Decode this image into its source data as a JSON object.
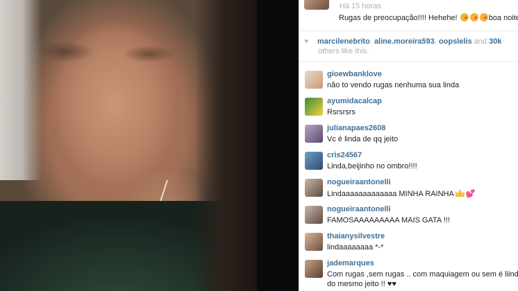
{
  "post": {
    "time": "Há 15 horas",
    "caption": "Rugas de preocupação!!!! Hehehe!",
    "caption_tail": "boa noite!"
  },
  "likes": {
    "users": [
      "marcilenebrito",
      "aline.moreira593",
      "oopslelis"
    ],
    "connector": "and",
    "count": "30k",
    "suffix": "others like this."
  },
  "comments": [
    {
      "username": "gioewbanklove",
      "text": "não to vendo rugas nenhuma sua linda",
      "avatar_colors": [
        "#e9d9c8",
        "#c89a7a"
      ]
    },
    {
      "username": "ayumidacalcap",
      "text": "Rsrsrsrs",
      "avatar_colors": [
        "#3a8a3c",
        "#f2d23a"
      ]
    },
    {
      "username": "julianapaes2608",
      "text": "Vc é linda de qq jeito",
      "avatar_colors": [
        "#b9a6c6",
        "#5c4a6a"
      ]
    },
    {
      "username": "cris24567",
      "text": "Linda,beijinho no ombro!!!!",
      "avatar_colors": [
        "#6fa0c8",
        "#2f4a6c"
      ]
    },
    {
      "username": "nogueiraantonelli",
      "text": "Lindaaaaaaaaaaaaa MINHA RAINHA",
      "avatar_colors": [
        "#c8b7aa",
        "#5e4c42"
      ],
      "icons": [
        "crown-icon",
        "hearts-icon"
      ]
    },
    {
      "username": "nogueiraantonelli",
      "text": "FAMOSAAAAAAAAA MAIS GATA !!!",
      "avatar_colors": [
        "#c8b7aa",
        "#5e4c42"
      ]
    },
    {
      "username": "thaianysilvestre",
      "text": "lindaaaaaaaa *-*",
      "avatar_colors": [
        "#d8b8a0",
        "#6e4e3c"
      ]
    },
    {
      "username": "jademarques",
      "text": "Com rugas ,sem rugas .. com maquiagem ou sem é liinda",
      "text2": "do mesmo jeito !! ♥♥",
      "avatar_colors": [
        "#c9a48a",
        "#5a3e30"
      ]
    }
  ],
  "colors": {
    "username": "#3f6f96",
    "muted": "#a9b2ba",
    "divider": "#08090a"
  }
}
